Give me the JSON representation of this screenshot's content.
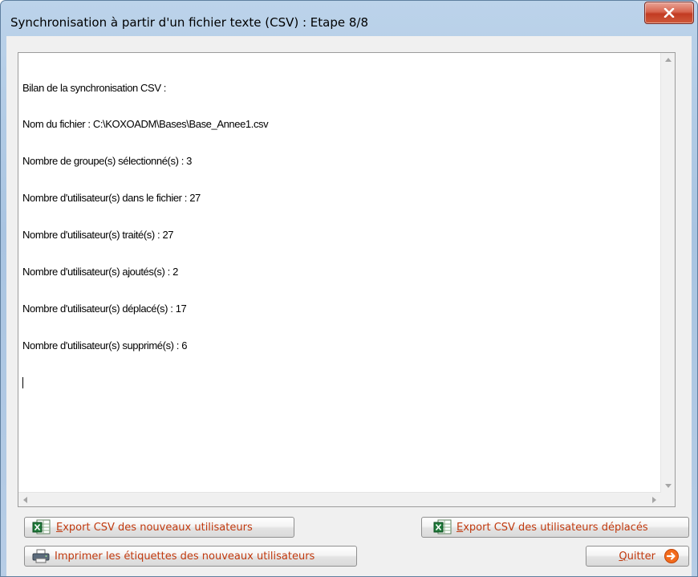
{
  "window": {
    "title": "Synchronisation à partir d'un fichier texte (CSV) : Etape 8/8",
    "close_glyph": "X"
  },
  "report": {
    "lines": [
      "Bilan de la synchronisation CSV :",
      "Nom du fichier : C:\\KOXOADM\\Bases\\Base_Annee1.csv",
      "Nombre de groupe(s) sélectionné(s) : 3",
      "Nombre d'utilisateur(s) dans le fichier : 27",
      "Nombre d'utilisateur(s) traité(s) : 27",
      "Nombre d'utilisateur(s) ajoutés(s) : 2",
      "Nombre d'utilisateur(s) déplacé(s) : 17",
      "Nombre d'utilisateur(s) supprimé(s) : 6"
    ]
  },
  "buttons": {
    "export_new": {
      "accel": "E",
      "rest": "xport CSV des nouveaux utilisateurs",
      "icon": "excel-icon"
    },
    "export_moved": {
      "accel": "E",
      "rest": "xport CSV des utilisateurs déplacés",
      "icon": "excel-icon"
    },
    "print_labels": {
      "text": "Imprimer les étiquettes des nouveaux utilisateurs",
      "icon": "printer-icon"
    },
    "quit": {
      "accel": "Q",
      "rest": "uitter",
      "icon": "arrow-right-circle-icon"
    }
  },
  "colors": {
    "button_text": "#c0390e",
    "close_button": "#c23b22",
    "quit_icon": "#f26b1d",
    "excel_green": "#1f7a3a"
  }
}
